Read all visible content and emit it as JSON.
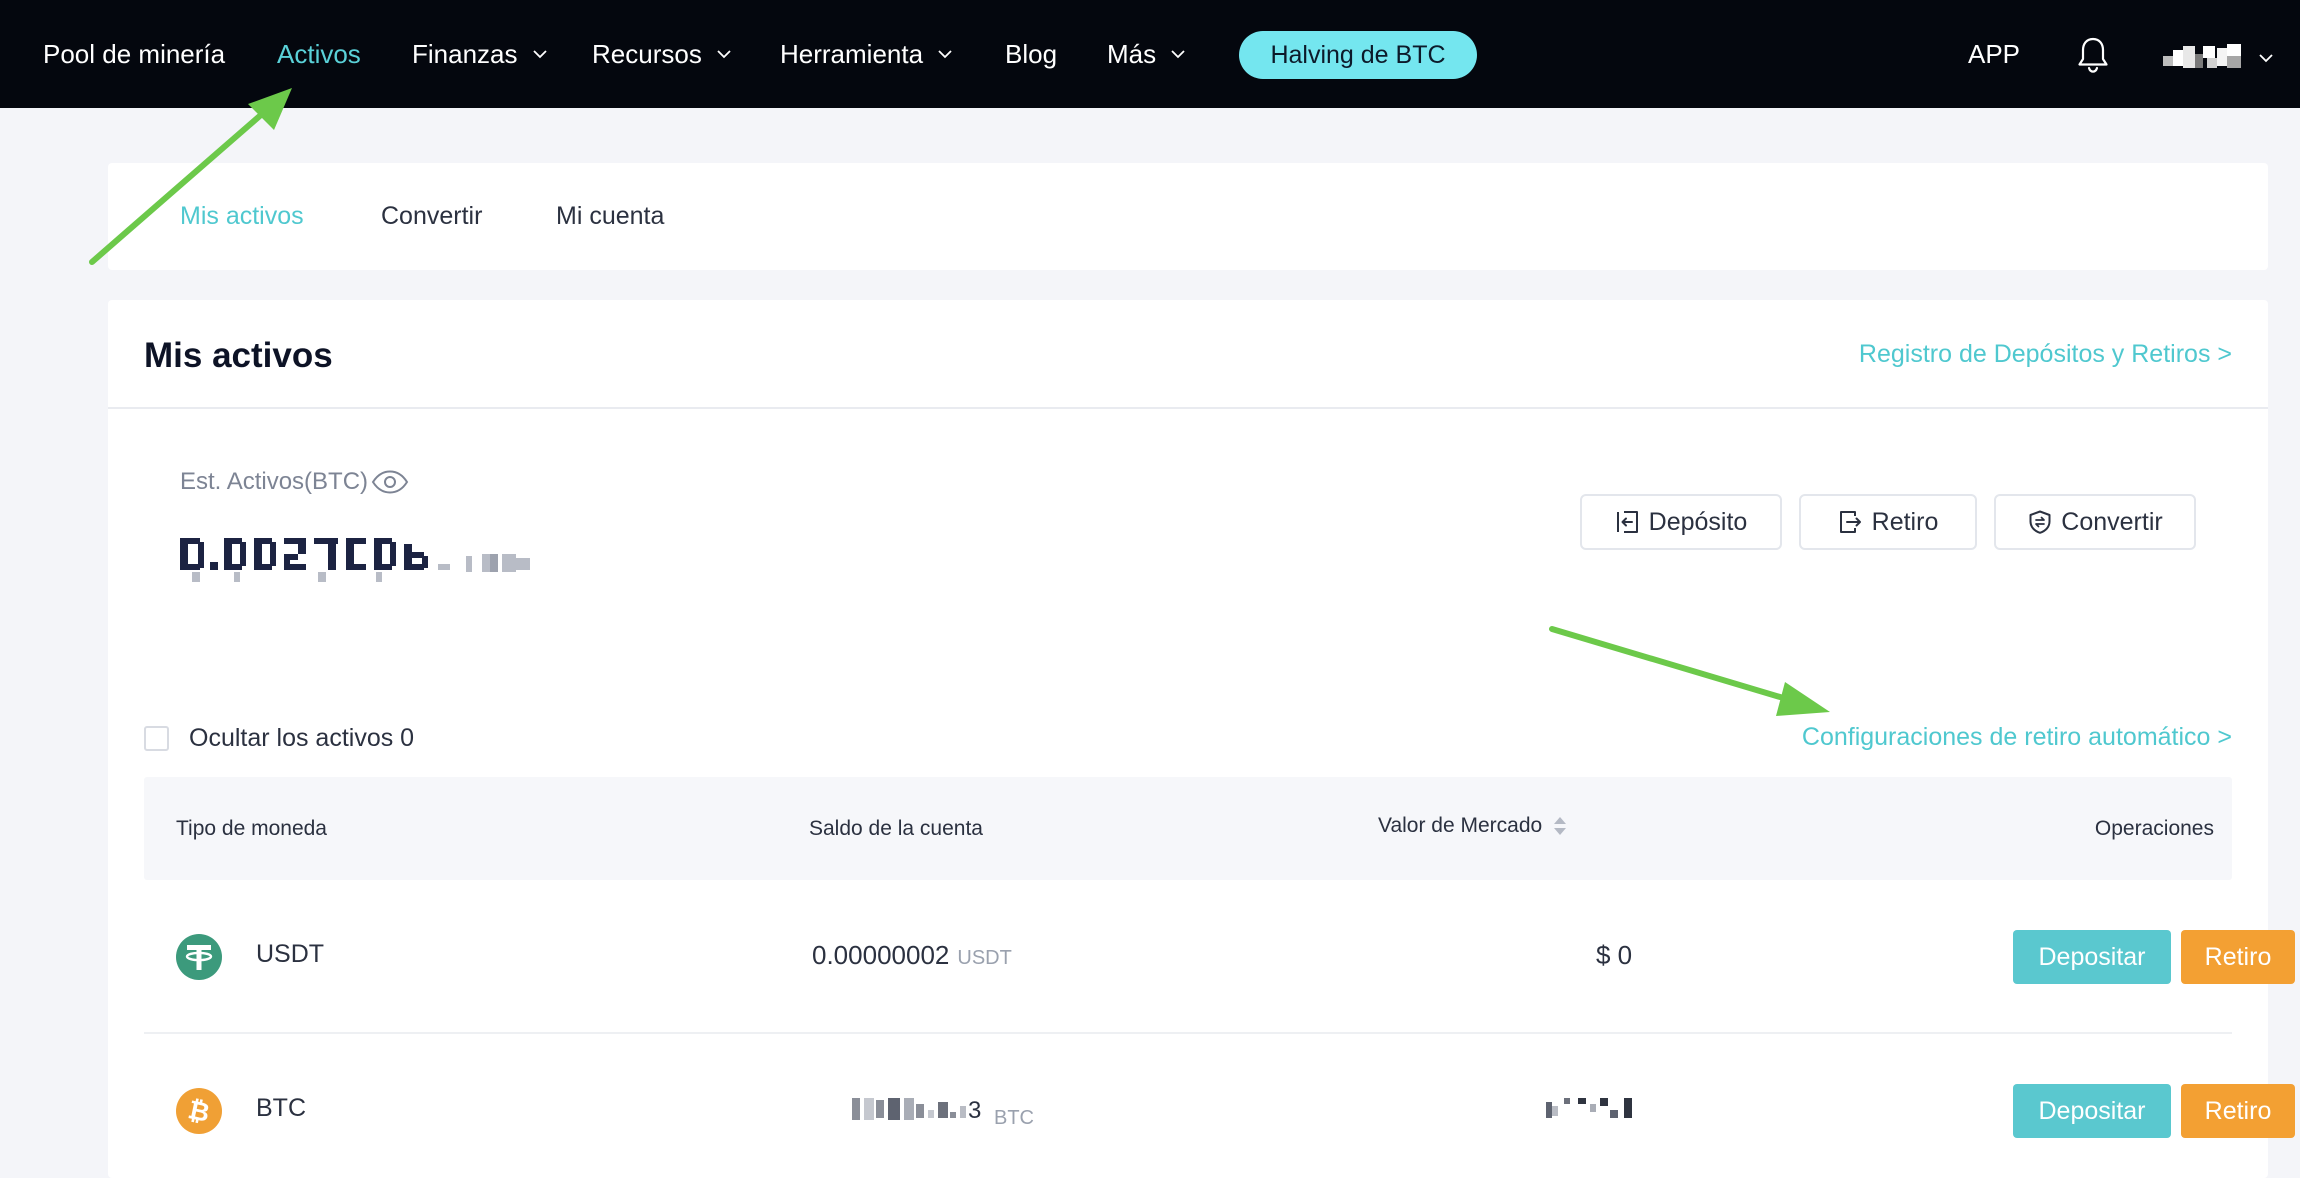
{
  "nav": {
    "items": [
      {
        "label": "Pool de minería",
        "has_dropdown": false,
        "active": false
      },
      {
        "label": "Activos",
        "has_dropdown": false,
        "active": true
      },
      {
        "label": "Finanzas",
        "has_dropdown": true,
        "active": false
      },
      {
        "label": "Recursos",
        "has_dropdown": true,
        "active": false
      },
      {
        "label": "Herramienta",
        "has_dropdown": true,
        "active": false
      },
      {
        "label": "Blog",
        "has_dropdown": false,
        "active": false
      },
      {
        "label": "Más",
        "has_dropdown": true,
        "active": false
      }
    ],
    "promo_button": "Halving de BTC",
    "app_label": "APP",
    "icons": {
      "bell": "bell-icon",
      "dropdown": "chevron-down-icon"
    }
  },
  "tabs": [
    {
      "label": "Mis activos",
      "active": true
    },
    {
      "label": "Convertir",
      "active": false
    },
    {
      "label": "Mi cuenta",
      "active": false
    }
  ],
  "assets": {
    "title": "Mis activos",
    "history_link": "Registro de Depósitos y Retiros >",
    "estimate_label": "Est. Activos(BTC)",
    "actions": {
      "deposit": "Depósito",
      "withdraw": "Retiro",
      "convert": "Convertir"
    },
    "hide_zero_label": "Ocultar los activos 0",
    "auto_withdraw_link": "Configuraciones de retiro automático >"
  },
  "table": {
    "headers": {
      "coin": "Tipo de moneda",
      "balance": "Saldo de la cuenta",
      "market": "Valor de Mercado",
      "ops": "Operaciones"
    },
    "rows": [
      {
        "coin": "USDT",
        "balance": "0.00000002",
        "unit": "USDT",
        "market": "$ 0",
        "deposit": "Depositar",
        "withdraw": "Retiro"
      },
      {
        "coin": "BTC",
        "balance": "",
        "unit": "BTC",
        "market": "",
        "deposit": "Depositar",
        "withdraw": "Retiro"
      }
    ]
  },
  "colors": {
    "accent": "#4fc8cf",
    "nav_bg": "#04070e",
    "promo_bg": "#74e6ef",
    "withdraw_btn": "#f3a033",
    "deposit_btn": "#5ac8cf",
    "annotation_arrow": "#6cc94a",
    "usdt": "#3c9a7c",
    "btc": "#f0a035"
  }
}
